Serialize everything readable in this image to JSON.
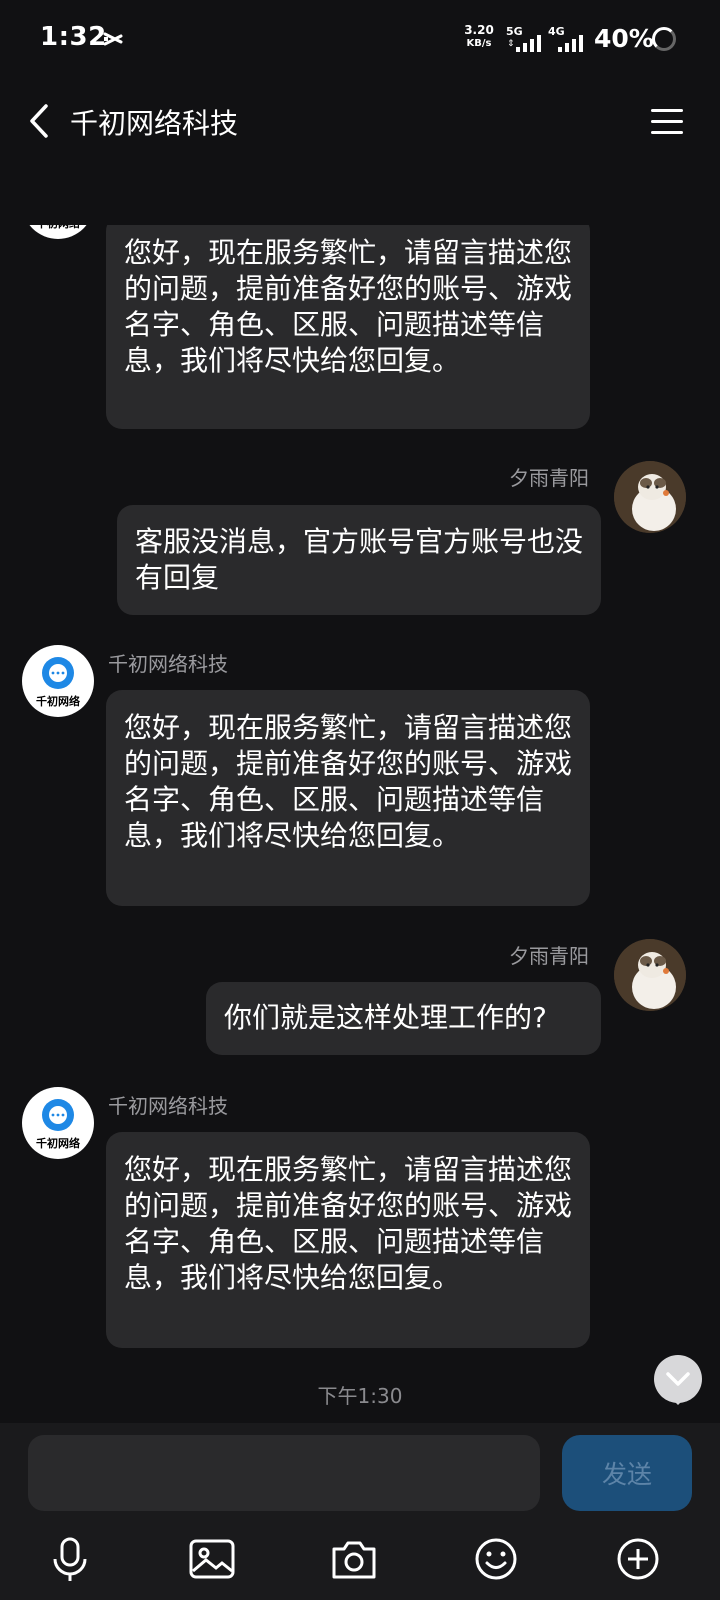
{
  "status_bar": {
    "time": "1:32",
    "net_speed_value": "3.20",
    "net_speed_unit": "KB/s",
    "signal1_label": "5G",
    "signal2_label": "4G",
    "battery_percent": "40%"
  },
  "header": {
    "title": "千初网络科技",
    "back_icon": "chevron-left-icon",
    "menu_icon": "hamburger-menu-icon"
  },
  "messages": [
    {
      "from": "agent",
      "sender": "",
      "text": "您好，现在服务繁忙，请留言描述您的问题，提前准备好您的账号、游戏名字、角色、区服、问题描述等信息，我们将尽快给您回复。"
    },
    {
      "from": "user",
      "sender": "夕雨青阳",
      "text": "客服没消息，官方账号官方账号也没有回复"
    },
    {
      "from": "agent",
      "sender": "千初网络科技",
      "text": "您好，现在服务繁忙，请留言描述您的问题，提前准备好您的账号、游戏名字、角色、区服、问题描述等信息，我们将尽快给您回复。"
    },
    {
      "from": "user",
      "sender": "夕雨青阳",
      "text": "你们就是这样处理工作的?"
    },
    {
      "from": "agent",
      "sender": "千初网络科技",
      "text": "您好，现在服务繁忙，请留言描述您的问题，提前准备好您的账号、游戏名字、角色、区服、问题描述等信息，我们将尽快给您回复。"
    }
  ],
  "logo_text": "千初网络",
  "timestamp": "下午1:30",
  "input": {
    "placeholder": "",
    "send_label": "发送"
  },
  "toolbar_icons": [
    "microphone-icon",
    "image-icon",
    "camera-icon",
    "emoji-icon",
    "plus-circle-icon"
  ],
  "colors": {
    "background": "#111113",
    "bubble": "#2a2a2c",
    "send_button": "#1c4f7a",
    "logo_blue": "#1e88e5"
  }
}
